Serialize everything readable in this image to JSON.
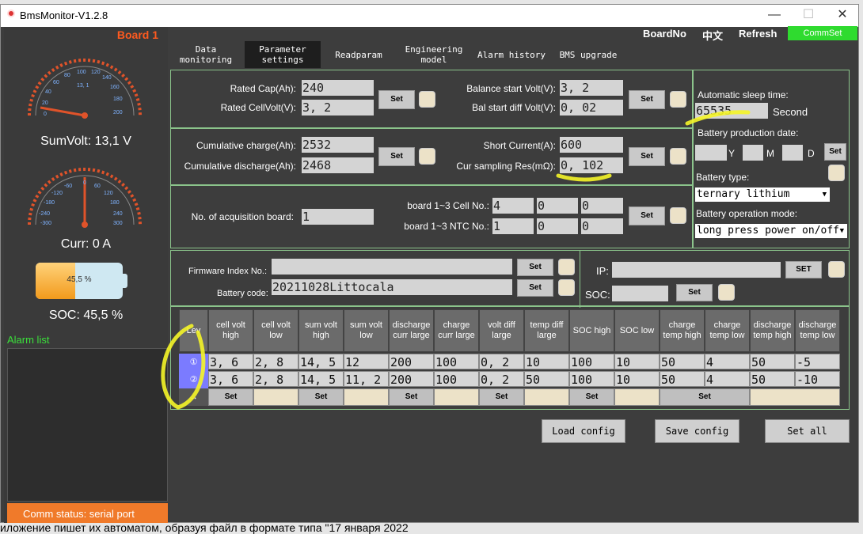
{
  "window": {
    "title": "BmsMonitor-V1.2.8",
    "minimize": "—",
    "maximize": "☐",
    "close": "✕"
  },
  "left": {
    "board": "Board 1",
    "sumvolt_label": "SumVolt: 13,1 V",
    "curr_label": "Curr: 0 A",
    "soc_label": "SOC: 45,5 %",
    "battery_percent": "45,5 %",
    "soc_fraction": 0.455,
    "alarm_list": "Alarm list",
    "comm_status": "Comm status: serial port",
    "gauge1_ticks": [
      "0",
      "20",
      "40",
      "60",
      "80",
      "100",
      "120",
      "140",
      "160",
      "180",
      "200"
    ],
    "gauge1_value": "13, 1",
    "gauge2_ticks": [
      "-300",
      "-240",
      "-180",
      "-120",
      "-60",
      "0",
      "60",
      "120",
      "180",
      "240",
      "300"
    ]
  },
  "header": {
    "board_no": "BoardNo",
    "lang": "中文",
    "refresh": "Refresh",
    "commset": "CommSet"
  },
  "tabs": [
    {
      "label1": "Data",
      "label2": "monitoring"
    },
    {
      "label1": "Parameter",
      "label2": "settings"
    },
    {
      "label1": "Readparam",
      "label2": ""
    },
    {
      "label1": "Engineering",
      "label2": "model"
    },
    {
      "label1": "Alarm history",
      "label2": ""
    },
    {
      "label1": "BMS upgrade",
      "label2": ""
    }
  ],
  "p1": {
    "rated_cap_label": "Rated Cap(Ah):",
    "rated_cap": "240",
    "rated_cellvolt_label": "Rated CellVolt(V):",
    "rated_cellvolt": "3, 2",
    "balance_start_label": "Balance start Volt(V):",
    "balance_start": "3, 2",
    "bal_diff_label": "Bal start diff Volt(V):",
    "bal_diff": "0, 02"
  },
  "p2": {
    "cum_charge_label": "Cumulative charge(Ah):",
    "cum_charge": "2532",
    "cum_discharge_label": "Cumulative discharge(Ah):",
    "cum_discharge": "2468",
    "short_current_label": "Short Current(A):",
    "short_current": "600",
    "cur_res_label": "Cur sampling Res(mΩ):",
    "cur_res": "0, 102"
  },
  "p3": {
    "acq_label": "No. of acquisition board:",
    "acq": "1",
    "cell_label": "board 1~3 Cell No.:",
    "cell": [
      "4",
      "0",
      "0"
    ],
    "ntc_label": "board 1~3 NTC No.:",
    "ntc": [
      "1",
      "0",
      "0"
    ]
  },
  "right": {
    "sleep_label": "Automatic sleep time:",
    "sleep": "65535",
    "second": "Second",
    "prod_date_label": "Battery production date:",
    "y": "Y",
    "m": "M",
    "d": "D",
    "type_label": "Battery type:",
    "type": "ternary lithium",
    "mode_label": "Battery operation mode:",
    "mode": "long press power on/off"
  },
  "p4": {
    "firmware_label": "Firmware Index No.:",
    "firmware": "",
    "code_label": "Battery code:",
    "code": "20211028Littocala",
    "ip_label": "IP:",
    "soc_label": "SOC:",
    "set_upper": "SET"
  },
  "set": "Set",
  "table": {
    "headers": [
      "Lev",
      "cell volt high",
      "cell volt low",
      "sum volt high",
      "sum volt low",
      "discharge curr large",
      "charge curr large",
      "volt diff large",
      "temp diff large",
      "SOC high",
      "SOC low",
      "charge temp high",
      "charge temp low",
      "discharge temp high",
      "discharge temp low"
    ],
    "row1": [
      "3, 6",
      "2, 8",
      "14, 5",
      "12",
      "200",
      "100",
      "0, 2",
      "10",
      "100",
      "10",
      "50",
      "4",
      "50",
      "-5"
    ],
    "row2": [
      "3, 6",
      "2, 8",
      "14, 5",
      "11, 2",
      "200",
      "100",
      "0, 2",
      "50",
      "100",
      "10",
      "50",
      "4",
      "50",
      "-10"
    ],
    "lev": [
      "①",
      "②",
      "→"
    ]
  },
  "bottom": {
    "load": "Load config",
    "save": "Save config",
    "setall": "Set all"
  },
  "behind_text": "иложение пишет их автоматом, образуя файл в формате типа \"17 января 2022"
}
